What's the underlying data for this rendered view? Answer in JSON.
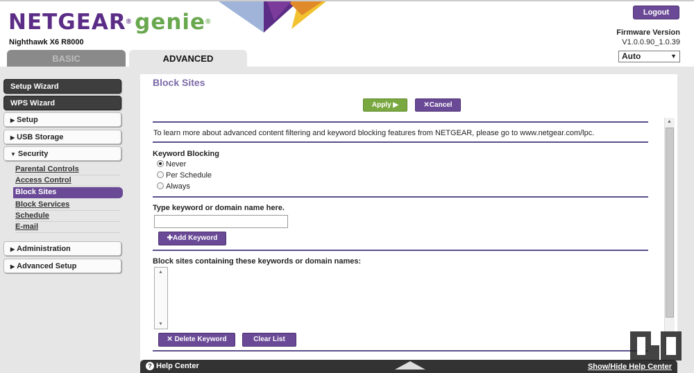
{
  "header": {
    "brand": "NETGEAR",
    "brand_mark": "®",
    "product": "genie",
    "product_mark": "®",
    "model": "Nighthawk X6 R8000",
    "logout_label": "Logout",
    "firmware_label": "Firmware Version",
    "firmware_version": "V1.0.0.90_1.0.39",
    "language_selected": "Auto"
  },
  "tabs": [
    {
      "label": "BASIC"
    },
    {
      "label": "ADVANCED"
    }
  ],
  "sidebar": {
    "setup_wizard": "Setup Wizard",
    "wps_wizard": "WPS Wizard",
    "setup": "Setup",
    "usb_storage": "USB Storage",
    "security": "Security",
    "security_items": [
      {
        "label": "Parental Controls"
      },
      {
        "label": "Access Control"
      },
      {
        "label": "Block Sites"
      },
      {
        "label": "Block Services"
      },
      {
        "label": "Schedule"
      },
      {
        "label": "E-mail"
      }
    ],
    "administration": "Administration",
    "advanced_setup": "Advanced Setup"
  },
  "main": {
    "title": "Block Sites",
    "apply_label": "Apply",
    "cancel_label": "Cancel",
    "intro": "To learn more about advanced content filtering and keyword blocking features from NETGEAR, please go to www.netgear.com/lpc.",
    "keyword_blocking_label": "Keyword Blocking",
    "options": [
      {
        "label": "Never",
        "selected": true
      },
      {
        "label": "Per Schedule",
        "selected": false
      },
      {
        "label": "Always",
        "selected": false
      }
    ],
    "keyword_input_label": "Type keyword or domain name here.",
    "keyword_input_value": "",
    "add_keyword_label": "Add Keyword",
    "blocked_list_label": "Block sites containing these keywords or domain names:",
    "delete_keyword_label": "Delete Keyword",
    "clear_list_label": "Clear List"
  },
  "footer": {
    "help_center": "Help Center",
    "show_hide": "Show/Hide Help Center"
  },
  "colors": {
    "brand_purple": "#5b2d86",
    "genie_green": "#6aa84f",
    "button_purple": "#6a4a96",
    "apply_green": "#7aa840"
  }
}
